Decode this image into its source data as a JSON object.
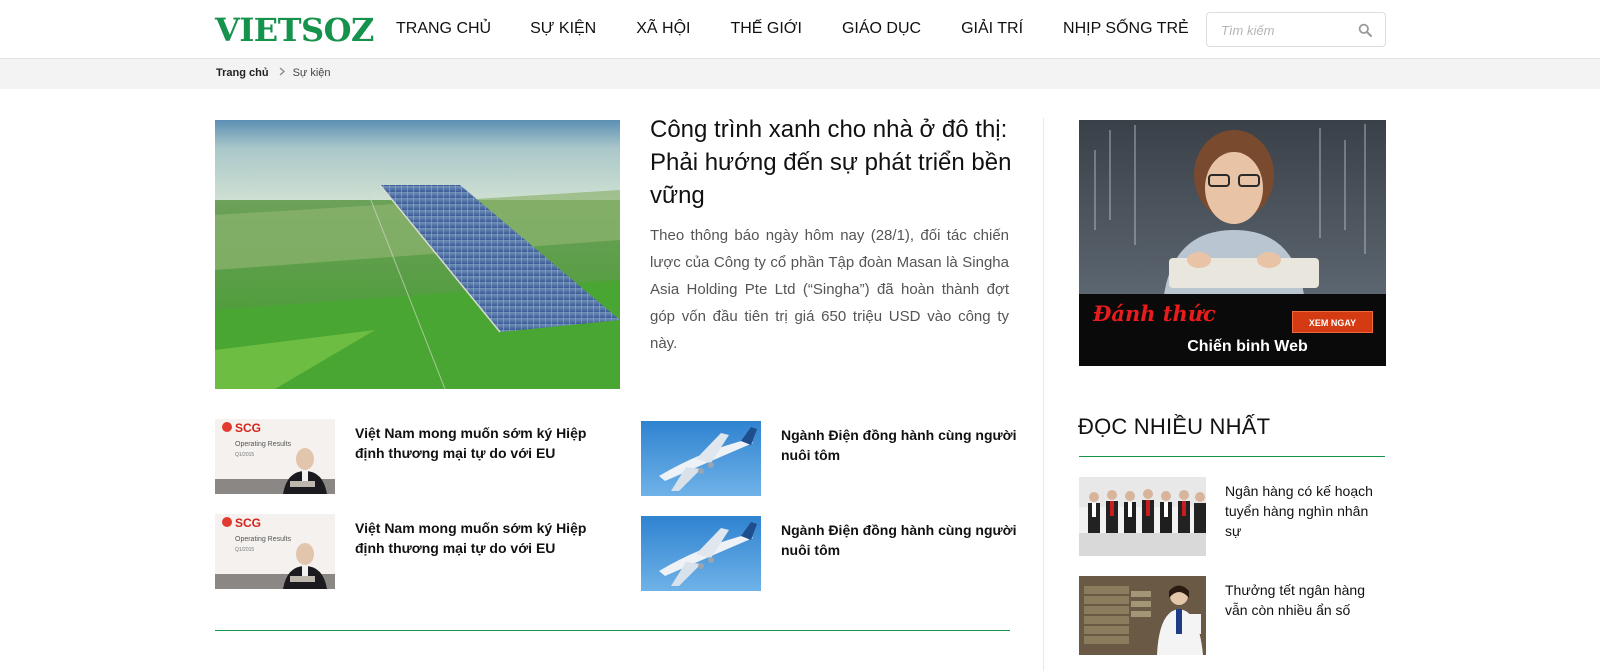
{
  "header": {
    "logo_text": "VIETSOZ",
    "brand_color": "#15924c",
    "nav": [
      {
        "label": "TRANG CHỦ"
      },
      {
        "label": "SỰ KIỆN"
      },
      {
        "label": "XÃ HỘI"
      },
      {
        "label": "THẾ GIỚI"
      },
      {
        "label": "GIÁO DỤC"
      },
      {
        "label": "GIẢI TRÍ"
      },
      {
        "label": "NHỊP SỐNG TRẺ"
      }
    ],
    "search": {
      "placeholder": "Tìm kiếm",
      "icon": "search-icon"
    }
  },
  "breadcrumb": {
    "home": "Trang chủ",
    "separator_icon": "chevron-right-icon",
    "current": "Sự kiện"
  },
  "featured": {
    "title": "Công trình xanh cho nhà ở đô thị: Phải hướng đến sự phát triển bền vững",
    "description": "Theo thông báo ngày hôm nay (28/1), đối tác chiến lược của Công ty cổ phần Tập đoàn Masan là Singha Asia Holding Pte Ltd (“Singha”) đã hoàn thành đợt góp vốn đầu tiên trị giá 650 triệu USD vào công ty này.",
    "image": "solar-farm-aerial-photo"
  },
  "articles": [
    {
      "title": "Việt Nam mong muốn sớm ký Hiệp định thương mại tự do với EU",
      "image": "press-conference-photo",
      "thumb_text": "SCG",
      "thumb_sub": "Operating Results",
      "thumb_date": "Q1/2015"
    },
    {
      "title": "Ngành Điện đồng hành cùng người nuôi tôm",
      "image": "airplane-photo"
    },
    {
      "title": "Việt Nam mong muốn sớm ký Hiệp định thương mại tự do với EU",
      "image": "press-conference-photo",
      "thumb_text": "SCG",
      "thumb_sub": "Operating Results",
      "thumb_date": "Q1/2015"
    },
    {
      "title": "Ngành Điện đồng hành cùng người nuôi tôm",
      "image": "airplane-photo"
    }
  ],
  "sidebar": {
    "ad": {
      "headline": "Đánh thức",
      "subline": "Chiến binh Web",
      "button": "XEM NGAY",
      "image": "boy-at-keyboard-photo"
    },
    "most_read_title": "ĐỌC NHIỀU NHẤT",
    "most_read": [
      {
        "title": "Ngân hàng có kế hoạch tuyển hàng nghìn nhân sự",
        "image": "bank-staff-photo"
      },
      {
        "title": "Thưởng tết ngân hàng vẫn còn nhiều ẩn số",
        "image": "bank-teller-photo"
      }
    ]
  }
}
